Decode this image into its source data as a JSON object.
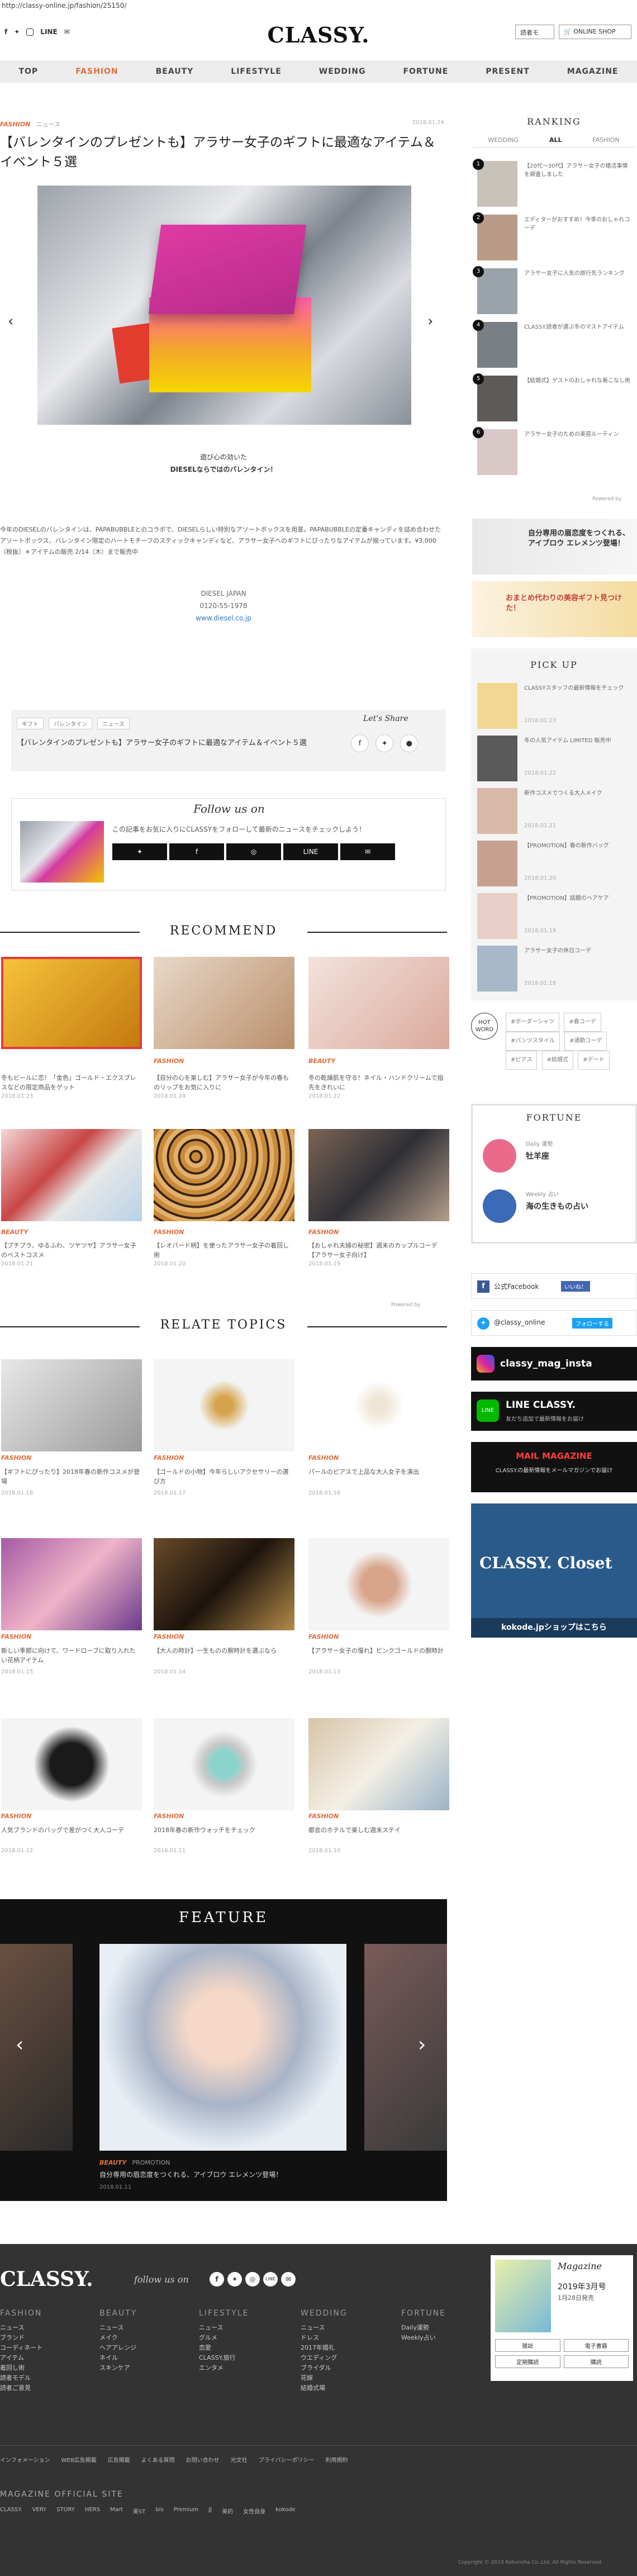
{
  "url": "http://classy-online.jp/fashion/25150/",
  "header": {
    "social": [
      "LINE"
    ],
    "logo": "CLASSY.",
    "btn_recommend": "読者モ",
    "btn_shop": "ONLINE SHOP"
  },
  "nav": [
    "TOP",
    "FASHION",
    "BEAUTY",
    "LIFESTYLE",
    "WEDDING",
    "FORTUNE",
    "PRESENT",
    "MAGAZINE"
  ],
  "article": {
    "category": "FASHION",
    "subcategory": "ニュース",
    "date": "2018.01.24",
    "title": "【バレンタインのプレゼントも】アラサー女子のギフトに最適なアイテム＆イベント５選",
    "caption1": "遊び心の効いた",
    "caption2": "DIESELならではのバレンタイン！",
    "body": "今年のDIESELのバレンタインは、PAPABUBBLEとのコラボで、DIESELらしい特別なアソートボックスを用意。PAPABUBBLEの定番キャンディを詰め合わせたアソートボックス、バレンタイン限定のハートモチーフのスティックキャンディなど、アラサー女子へのギフトにぴったりなアイテムが揃っています。¥3,000（税抜）＊アイテムの販売 2/14（木）まで販売中",
    "info1": "DIESEL JAPAN",
    "info2": "0120-55-1978",
    "info3": "www.diesel.co.jp",
    "tags": [
      "ギフト",
      "バレンタイン",
      "ニュース"
    ],
    "share_label": "Let's Share",
    "share_title": "【バレンタインのプレゼントも】アラサー女子のギフトに最適なアイテム＆イベント５選"
  },
  "follow": {
    "title": "Follow us on",
    "text": "この記事をお気に入りにCLASSYをフォローして最新のニュースをチェックしよう！",
    "buttons": [
      "twitter",
      "f",
      "camera",
      "LINE",
      "mail"
    ]
  },
  "recommend": {
    "title": "RECOMMEND",
    "cards": [
      {
        "cat": "",
        "title": "冬もビールに恋！「金色」ゴールド・エクスプレスなどの限定商品をゲット",
        "date": "2018.01.23"
      },
      {
        "cat": "FASHION",
        "title": "【自分の心を楽しむ】アラサー女子が今年の春ものリップをお気に入りに",
        "date": "2018.01.24"
      },
      {
        "cat": "BEAUTY",
        "title": "冬の乾燥肌を守る！ネイル・ハンドクリームで指先をきれいに",
        "date": "2018.01.22"
      },
      {
        "cat": "BEAUTY",
        "title": "【プチプラ、ゆるふわ、ツヤツヤ】アラサー女子のベストコスメ",
        "date": "2018.01.21"
      },
      {
        "cat": "FASHION",
        "title": "【レオパード柄】を使ったアラサー女子の着回し術",
        "date": "2018.01.20"
      },
      {
        "cat": "FASHION",
        "title": "【おしゃれ夫婦の秘密】週末のカップルコーデ【アラサー女子向け】",
        "date": "2018.01.19"
      }
    ]
  },
  "relate": {
    "title": "RELATE TOPICS",
    "cards": [
      {
        "title": "【ギフトにぴったり】2018年春の新作コスメが登場",
        "date": "2018.01.18"
      },
      {
        "title": "【ゴールドの小物】今年らしいアクセサリーの選び方",
        "date": "2018.01.17"
      },
      {
        "title": "パールのピアスで上品な大人女子を演出",
        "date": "2018.01.16"
      },
      {
        "title": "新しい季節に向けて、ワードローブに取り入れたい花柄アイテム",
        "date": "2018.01.15"
      },
      {
        "title": "【大人の時計】一生ものの腕時計を選ぶなら",
        "date": "2018.01.14"
      },
      {
        "title": "【アラサー女子の憧れ】ピンクゴールドの腕時計",
        "date": "2018.01.13"
      },
      {
        "title": "人気ブランドのバッグで差がつく大人コーデ",
        "date": "2018.01.12"
      },
      {
        "title": "2018年春の新作ウォッチをチェック",
        "date": "2018.01.11"
      },
      {
        "title": "都会のホテルで楽しむ週末ステイ",
        "date": "2018.01.10"
      }
    ]
  },
  "feature": {
    "title": "FEATURE",
    "cat": "BEAUTY",
    "sub": "PROMOTION",
    "text": "自分専用の眉恋度をつくれる、アイブロウ エレメンツ登場！",
    "date": "2018.01.11"
  },
  "sidebar": {
    "ranking_title": "RANKING",
    "ranking_tabs": [
      "WEDDING",
      "ALL",
      "FASHION"
    ],
    "ranking": [
      {
        "n": "1",
        "text": "【20代〜30代】アラサー女子の婚活事情を調査しました"
      },
      {
        "n": "2",
        "text": "エディターがおすすめ！今季のおしゃれコーデ"
      },
      {
        "n": "3",
        "text": "アラサー女子に人気の旅行先ランキング"
      },
      {
        "n": "4",
        "text": "CLASSY.読者が選ぶ冬のマストアイテム"
      },
      {
        "n": "5",
        "text": "【結婚式】ゲストのおしゃれな着こなし術"
      },
      {
        "n": "6",
        "text": "アラサー女子のための美容ルーティン"
      }
    ],
    "powered": "Powered by",
    "pickup_title": "PICK UP",
    "pickup": [
      {
        "text": "CLASSYスタッフの最新情報をチェック",
        "date": "2018.01.23"
      },
      {
        "text": "冬の人気アイテム LIMITED 販売中",
        "date": "2018.01.22"
      },
      {
        "text": "新作コスメでつくる大人メイク",
        "date": "2018.01.21"
      },
      {
        "text": "【PROMOTION】春の新作バッグ",
        "date": "2018.01.20"
      },
      {
        "text": "【PROMOTION】話題のヘアケア",
        "date": "2018.01.19"
      },
      {
        "text": "アラサー女子の休日コーデ",
        "date": "2018.01.18"
      }
    ],
    "hotword": "HOT WORD",
    "hottags": [
      "#ボーダーシャツ",
      "#春コーデ",
      "#パンツスタイル",
      "#通勤コーデ",
      "#ピアス",
      "#結婚式",
      "#デート"
    ],
    "fortune_title": "FORTUNE",
    "fortune1_label": "Daily 運勢",
    "fortune1": "牡羊座",
    "fortune2_label": "Weekly 占い",
    "fortune2": "海の生きもの占い",
    "facebook": "公式Facebook",
    "facebook_btn": "いいね！",
    "twitter": "@classy_online",
    "twitter_btn": "フォローする",
    "instagram": "classy_mag_insta",
    "line": "LINE CLASSY.",
    "line_sub": "友だち追加で最新情報をお届け",
    "mail_title": "MAIL MAGAZINE",
    "mail_sub": "CLASSY.の最新情報をメールマガジンでお届け",
    "closet_title": "CLASSY. Closet",
    "closet_link": "kokode.jpショップはこちら",
    "banner1": "自分専用の眉恋度をつくれる、アイブロウ エレメンツ登場！",
    "banner2": "おまとめ代わりの美容ギフト見つけた！"
  },
  "footer": {
    "logo": "CLASSY.",
    "follow": "follow us on",
    "cols": [
      {
        "hd": "FASHION",
        "items": [
          "ニュース",
          "ブランド",
          "コーディネート",
          "アイテム",
          "着回し術",
          "読者モデル",
          "読者ご意見"
        ]
      },
      {
        "hd": "BEAUTY",
        "items": [
          "ニュース",
          "メイク",
          "ヘアアレンジ",
          "ネイル",
          "スキンケア"
        ]
      },
      {
        "hd": "LIFESTYLE",
        "items": [
          "ニュース",
          "グルメ",
          "恋愛",
          "CLASSY.旅行",
          "エンタメ"
        ]
      },
      {
        "hd": "WEDDING",
        "items": [
          "ニュース",
          "ドレス",
          "2017年婚礼",
          "ウエディング",
          "ブライダル",
          "花嫁",
          "結婚式場"
        ]
      },
      {
        "hd": "FORTUNE",
        "items": [
          "Daily運勢",
          "Weekly占い"
        ]
      }
    ],
    "magazine_title": "Magazine",
    "magazine_issue": "2019年3月号",
    "magazine_date": "1月28日発売",
    "magazine_btns": [
      "雑誌",
      "電子書籍",
      "定期購読",
      "購読"
    ],
    "links": [
      "インフォメーション",
      "WEB広告掲載",
      "広告掲載",
      "よくある質問",
      "お問い合わせ",
      "光文社",
      "プライバシーポリシー",
      "利用規約"
    ],
    "official_title": "MAGAZINE OFFICIAL SITE",
    "officials": [
      "CLASSY.",
      "VERY",
      "STORY",
      "HERS",
      "Mart",
      "美ST",
      "bis",
      "Premium",
      "JJ",
      "美的",
      "女性自身",
      "kokode"
    ],
    "copyright": "Copyright © 2019 Kobunsha Co.,Ltd. All Rights Reserved."
  }
}
